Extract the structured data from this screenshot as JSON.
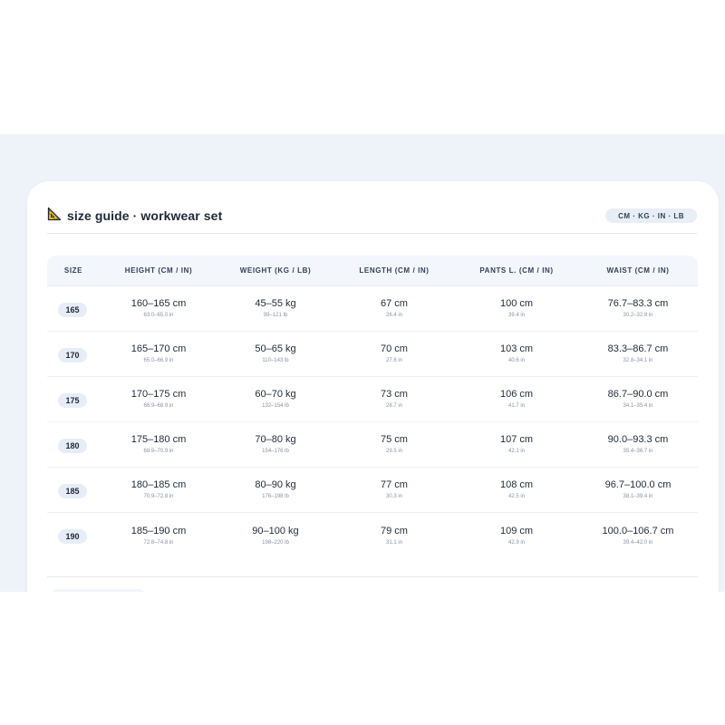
{
  "header": {
    "icon": "triangle-ruler-icon",
    "title": "size guide · workwear set",
    "units": "CM · KG · IN · LB"
  },
  "table": {
    "columns": [
      "SIZE",
      "HEIGHT (CM / IN)",
      "WEIGHT (KG / LB)",
      "LENGTH (CM / IN)",
      "PANTS L. (CM / IN)",
      "WAIST (CM / IN)"
    ],
    "rows": [
      {
        "size": "165",
        "height": "160–165 cm",
        "height_in": "63.0–65.0 in",
        "weight": "45–55 kg",
        "weight_lb": "99–121 lb",
        "length": "67 cm",
        "length_in": "26.4 in",
        "pants": "100 cm",
        "pants_in": "39.4 in",
        "waist": "76.7–83.3 cm",
        "waist_in": "30.2–32.8 in"
      },
      {
        "size": "170",
        "height": "165–170 cm",
        "height_in": "65.0–66.9 in",
        "weight": "50–65 kg",
        "weight_lb": "110–143 lb",
        "length": "70 cm",
        "length_in": "27.6 in",
        "pants": "103 cm",
        "pants_in": "40.6 in",
        "waist": "83.3–86.7 cm",
        "waist_in": "32.8–34.1 in"
      },
      {
        "size": "175",
        "height": "170–175 cm",
        "height_in": "66.9–68.9 in",
        "weight": "60–70 kg",
        "weight_lb": "132–154 lb",
        "length": "73 cm",
        "length_in": "28.7 in",
        "pants": "106 cm",
        "pants_in": "41.7 in",
        "waist": "86.7–90.0 cm",
        "waist_in": "34.1–35.4 in"
      },
      {
        "size": "180",
        "height": "175–180 cm",
        "height_in": "68.9–70.9 in",
        "weight": "70–80 kg",
        "weight_lb": "154–176 lb",
        "length": "75 cm",
        "length_in": "29.5 in",
        "pants": "107 cm",
        "pants_in": "42.1 in",
        "waist": "90.0–93.3 cm",
        "waist_in": "35.4–36.7 in"
      },
      {
        "size": "185",
        "height": "180–185 cm",
        "height_in": "70.9–72.8 in",
        "weight": "80–90 kg",
        "weight_lb": "176–198 lb",
        "length": "77 cm",
        "length_in": "30.3 in",
        "pants": "108 cm",
        "pants_in": "42.5 in",
        "waist": "96.7–100.0 cm",
        "waist_in": "38.1–39.4 in"
      },
      {
        "size": "190",
        "height": "185–190 cm",
        "height_in": "72.8–74.8 in",
        "weight": "90–100 kg",
        "weight_lb": "198–220 lb",
        "length": "79 cm",
        "length_in": "31.1 in",
        "pants": "109 cm",
        "pants_in": "42.9 in",
        "waist": "100.0–106.7 cm",
        "waist_in": "39.4–42.0 in"
      }
    ]
  },
  "colors": {
    "background": "#eef2f9",
    "card": "#ffffff",
    "badge": "#e6edf6",
    "icon_fill": "#f5c518",
    "icon_stroke": "#1f2937"
  }
}
